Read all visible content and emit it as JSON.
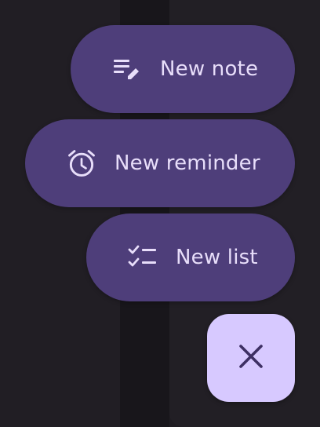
{
  "fab_menu": {
    "actions": [
      {
        "label": "New note",
        "icon": "note-edit-icon"
      },
      {
        "label": "New reminder",
        "icon": "alarm-clock-icon"
      },
      {
        "label": "New list",
        "icon": "checklist-icon"
      }
    ],
    "close_icon": "close-icon"
  },
  "colors": {
    "background": "#1f1c22",
    "action_pill": "#4e3e7a",
    "action_text": "#e8defa",
    "close_fab": "#d7c9ff",
    "close_icon": "#3d2f63"
  }
}
